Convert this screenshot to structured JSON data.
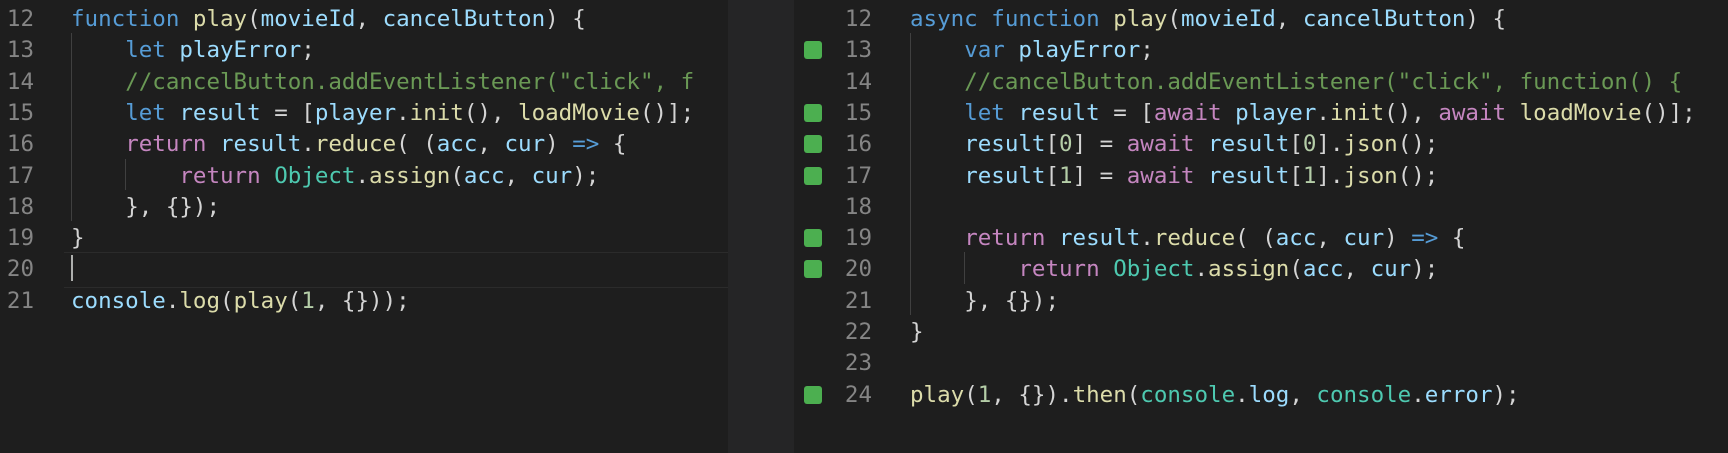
{
  "left_editor": {
    "lines": [
      {
        "n": "12",
        "tokens": [
          [
            "function",
            "kw"
          ],
          [
            " ",
            "plain"
          ],
          [
            "play",
            "fn"
          ],
          [
            "(",
            "plain"
          ],
          [
            "movieId",
            "var"
          ],
          [
            ", ",
            "plain"
          ],
          [
            "cancelButton",
            "var"
          ],
          [
            ") {",
            "plain"
          ]
        ]
      },
      {
        "n": "13",
        "tokens": [
          [
            "    ",
            "plain"
          ],
          [
            "let",
            "kw"
          ],
          [
            " ",
            "plain"
          ],
          [
            "playError",
            "var"
          ],
          [
            ";",
            "plain"
          ]
        ]
      },
      {
        "n": "14",
        "tokens": [
          [
            "    ",
            "plain"
          ],
          [
            "//cancelButton.addEventListener(\"click\", f",
            "comment"
          ]
        ]
      },
      {
        "n": "15",
        "tokens": [
          [
            "    ",
            "plain"
          ],
          [
            "let",
            "kw"
          ],
          [
            " ",
            "plain"
          ],
          [
            "result",
            "var"
          ],
          [
            " = [",
            "plain"
          ],
          [
            "player",
            "var"
          ],
          [
            ".",
            "plain"
          ],
          [
            "init",
            "fn"
          ],
          [
            "(), ",
            "plain"
          ],
          [
            "loadMovie",
            "fn"
          ],
          [
            "()];",
            "plain"
          ]
        ]
      },
      {
        "n": "16",
        "tokens": [
          [
            "    ",
            "plain"
          ],
          [
            "return",
            "ctl"
          ],
          [
            " ",
            "plain"
          ],
          [
            "result",
            "var"
          ],
          [
            ".",
            "plain"
          ],
          [
            "reduce",
            "fn"
          ],
          [
            "( (",
            "plain"
          ],
          [
            "acc",
            "var"
          ],
          [
            ", ",
            "plain"
          ],
          [
            "cur",
            "var"
          ],
          [
            ") ",
            "plain"
          ],
          [
            "=>",
            "kw"
          ],
          [
            " {",
            "plain"
          ]
        ]
      },
      {
        "n": "17",
        "tokens": [
          [
            "        ",
            "plain"
          ],
          [
            "return",
            "ctl"
          ],
          [
            " ",
            "plain"
          ],
          [
            "Object",
            "type"
          ],
          [
            ".",
            "plain"
          ],
          [
            "assign",
            "fn"
          ],
          [
            "(",
            "plain"
          ],
          [
            "acc",
            "var"
          ],
          [
            ", ",
            "plain"
          ],
          [
            "cur",
            "var"
          ],
          [
            ");",
            "plain"
          ]
        ]
      },
      {
        "n": "18",
        "tokens": [
          [
            "    ",
            "plain"
          ],
          [
            "}, {});",
            "plain"
          ]
        ]
      },
      {
        "n": "19",
        "tokens": [
          [
            "}",
            "plain"
          ]
        ]
      },
      {
        "n": "20",
        "tokens": []
      },
      {
        "n": "21",
        "tokens": [
          [
            "console",
            "var"
          ],
          [
            ".",
            "plain"
          ],
          [
            "log",
            "fn"
          ],
          [
            "(",
            "plain"
          ],
          [
            "play",
            "fn"
          ],
          [
            "(",
            "plain"
          ],
          [
            "1",
            "num"
          ],
          [
            ", {}));",
            "plain"
          ]
        ]
      }
    ]
  },
  "right_editor": {
    "lines": [
      {
        "n": "12",
        "added": false,
        "tokens": [
          [
            "async",
            "kw"
          ],
          [
            " ",
            "plain"
          ],
          [
            "function",
            "kw"
          ],
          [
            " ",
            "plain"
          ],
          [
            "play",
            "fn"
          ],
          [
            "(",
            "plain"
          ],
          [
            "movieId",
            "var"
          ],
          [
            ", ",
            "plain"
          ],
          [
            "cancelButton",
            "var"
          ],
          [
            ") {",
            "plain"
          ]
        ]
      },
      {
        "n": "13",
        "added": true,
        "tokens": [
          [
            "    ",
            "plain"
          ],
          [
            "var",
            "kw"
          ],
          [
            " ",
            "plain"
          ],
          [
            "playError",
            "var"
          ],
          [
            ";",
            "plain"
          ]
        ]
      },
      {
        "n": "14",
        "added": false,
        "tokens": [
          [
            "    ",
            "plain"
          ],
          [
            "//cancelButton.addEventListener(\"click\", function() {",
            "comment"
          ]
        ]
      },
      {
        "n": "15",
        "added": true,
        "tokens": [
          [
            "    ",
            "plain"
          ],
          [
            "let",
            "kw"
          ],
          [
            " ",
            "plain"
          ],
          [
            "result",
            "var"
          ],
          [
            " = [",
            "plain"
          ],
          [
            "await",
            "ctl"
          ],
          [
            " ",
            "plain"
          ],
          [
            "player",
            "var"
          ],
          [
            ".",
            "plain"
          ],
          [
            "init",
            "fn"
          ],
          [
            "(), ",
            "plain"
          ],
          [
            "await",
            "ctl"
          ],
          [
            " ",
            "plain"
          ],
          [
            "loadMovie",
            "fn"
          ],
          [
            "()];",
            "plain"
          ]
        ]
      },
      {
        "n": "16",
        "added": true,
        "tokens": [
          [
            "    ",
            "plain"
          ],
          [
            "result",
            "var"
          ],
          [
            "[",
            "plain"
          ],
          [
            "0",
            "num"
          ],
          [
            "] = ",
            "plain"
          ],
          [
            "await",
            "ctl"
          ],
          [
            " ",
            "plain"
          ],
          [
            "result",
            "var"
          ],
          [
            "[",
            "plain"
          ],
          [
            "0",
            "num"
          ],
          [
            "].",
            "plain"
          ],
          [
            "json",
            "fn"
          ],
          [
            "();",
            "plain"
          ]
        ]
      },
      {
        "n": "17",
        "added": true,
        "tokens": [
          [
            "    ",
            "plain"
          ],
          [
            "result",
            "var"
          ],
          [
            "[",
            "plain"
          ],
          [
            "1",
            "num"
          ],
          [
            "] = ",
            "plain"
          ],
          [
            "await",
            "ctl"
          ],
          [
            " ",
            "plain"
          ],
          [
            "result",
            "var"
          ],
          [
            "[",
            "plain"
          ],
          [
            "1",
            "num"
          ],
          [
            "].",
            "plain"
          ],
          [
            "json",
            "fn"
          ],
          [
            "();",
            "plain"
          ]
        ]
      },
      {
        "n": "18",
        "added": false,
        "tokens": []
      },
      {
        "n": "19",
        "added": true,
        "tokens": [
          [
            "    ",
            "plain"
          ],
          [
            "return",
            "ctl"
          ],
          [
            " ",
            "plain"
          ],
          [
            "result",
            "var"
          ],
          [
            ".",
            "plain"
          ],
          [
            "reduce",
            "fn"
          ],
          [
            "( (",
            "plain"
          ],
          [
            "acc",
            "var"
          ],
          [
            ", ",
            "plain"
          ],
          [
            "cur",
            "var"
          ],
          [
            ") ",
            "plain"
          ],
          [
            "=>",
            "kw"
          ],
          [
            " {",
            "plain"
          ]
        ]
      },
      {
        "n": "20",
        "added": true,
        "tokens": [
          [
            "        ",
            "plain"
          ],
          [
            "return",
            "ctl"
          ],
          [
            " ",
            "plain"
          ],
          [
            "Object",
            "type"
          ],
          [
            ".",
            "plain"
          ],
          [
            "assign",
            "fn"
          ],
          [
            "(",
            "plain"
          ],
          [
            "acc",
            "var"
          ],
          [
            ", ",
            "plain"
          ],
          [
            "cur",
            "var"
          ],
          [
            ");",
            "plain"
          ]
        ]
      },
      {
        "n": "21",
        "added": false,
        "tokens": [
          [
            "    ",
            "plain"
          ],
          [
            "}, {});",
            "plain"
          ]
        ]
      },
      {
        "n": "22",
        "added": false,
        "tokens": [
          [
            "}",
            "plain"
          ]
        ]
      },
      {
        "n": "23",
        "added": false,
        "tokens": []
      },
      {
        "n": "24",
        "added": true,
        "tokens": [
          [
            "play",
            "fn"
          ],
          [
            "(",
            "plain"
          ],
          [
            "1",
            "num"
          ],
          [
            ", {}).",
            "plain"
          ],
          [
            "then",
            "fn"
          ],
          [
            "(",
            "plain"
          ],
          [
            "console",
            "type"
          ],
          [
            ".",
            "plain"
          ],
          [
            "log",
            "var"
          ],
          [
            ", ",
            "plain"
          ],
          [
            "console",
            "type"
          ],
          [
            ".",
            "plain"
          ],
          [
            "error",
            "var"
          ],
          [
            ");",
            "plain"
          ]
        ]
      }
    ]
  },
  "colors": {
    "background": "#1e1e1e",
    "added_marker": "#4caf50",
    "keyword": "#569cd6",
    "function": "#dcdcaa",
    "variable": "#9cdcfe",
    "control": "#c586c0",
    "comment": "#6a9955",
    "type": "#4ec9b0"
  }
}
